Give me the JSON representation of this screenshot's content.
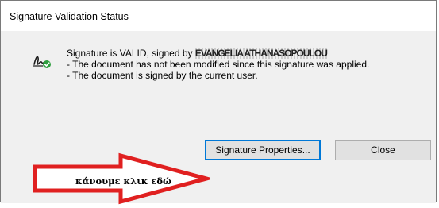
{
  "window": {
    "title": "Signature Validation Status"
  },
  "status": {
    "icon": "signature-valid-icon",
    "line1_prefix": "Signature is VALID, signed by ",
    "signer_name": "EVANGELIA ATHANASOPOULOU",
    "line2": "- The document has not been modified since this signature was applied.",
    "line3": "- The document is signed by the current user."
  },
  "buttons": {
    "signature_properties": "Signature Properties...",
    "close": "Close"
  },
  "annotation": {
    "label": "κάνουμε κλικ εδώ",
    "arrow_color": "#e02020"
  }
}
